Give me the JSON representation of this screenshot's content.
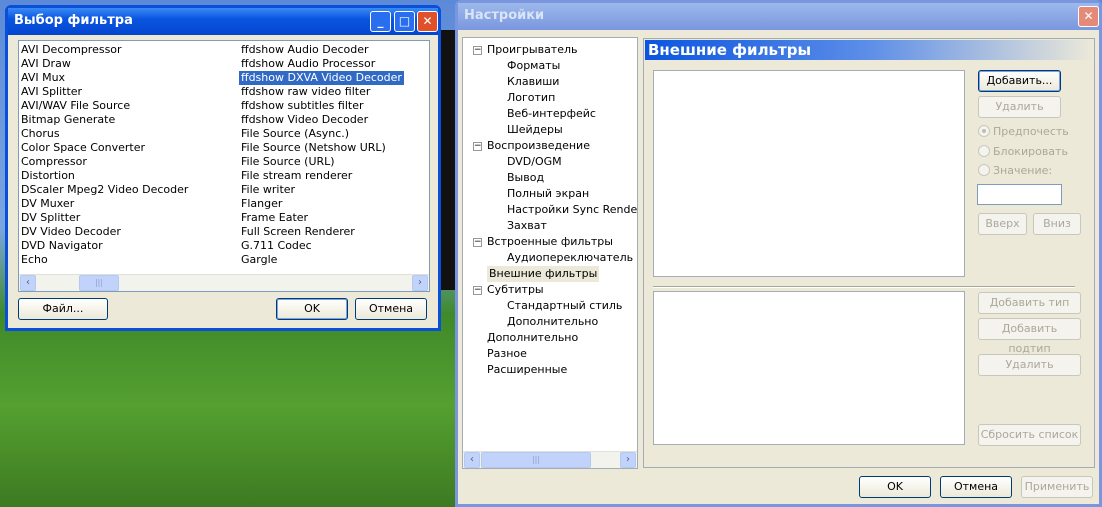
{
  "filter_dialog": {
    "title": "Выбор фильтра",
    "col1": [
      "AVI Decompressor",
      "AVI Draw",
      "AVI Mux",
      "AVI Splitter",
      "AVI/WAV File Source",
      "Bitmap Generate",
      "Chorus",
      "Color Space Converter",
      "Compressor",
      "Distortion",
      "DScaler Mpeg2 Video Decoder",
      "DV Muxer",
      "DV Splitter",
      "DV Video Decoder",
      "DVD Navigator",
      "Echo"
    ],
    "col2": [
      "ffdshow Audio Decoder",
      "ffdshow Audio Processor",
      "ffdshow DXVA Video Decoder",
      "ffdshow raw video filter",
      "ffdshow subtitles filter",
      "ffdshow Video Decoder",
      "File Source (Async.)",
      "File Source (Netshow URL)",
      "File Source (URL)",
      "File stream renderer",
      "File writer",
      "Flanger",
      "Frame Eater",
      "Full Screen Renderer",
      "G.711 Codec",
      "Gargle"
    ],
    "selected": "ffdshow DXVA Video Decoder",
    "file_button": "Файл...",
    "ok_button": "OK",
    "cancel_button": "Отмена"
  },
  "settings": {
    "title": "Настройки",
    "tree": [
      {
        "label": "Проигрыватель",
        "level": 0,
        "expander": true
      },
      {
        "label": "Форматы",
        "level": 1
      },
      {
        "label": "Клавиши",
        "level": 1
      },
      {
        "label": "Логотип",
        "level": 1
      },
      {
        "label": "Веб-интерфейс",
        "level": 1
      },
      {
        "label": "Шейдеры",
        "level": 1
      },
      {
        "label": "Воспроизведение",
        "level": 0,
        "expander": true
      },
      {
        "label": "DVD/OGM",
        "level": 1
      },
      {
        "label": "Вывод",
        "level": 1
      },
      {
        "label": "Полный экран",
        "level": 1
      },
      {
        "label": "Настройки Sync Renderer",
        "level": 1
      },
      {
        "label": "Захват",
        "level": 1
      },
      {
        "label": "Встроенные фильтры",
        "level": 0,
        "expander": true
      },
      {
        "label": "Аудиопереключатель",
        "level": 1
      },
      {
        "label": "Внешние фильтры",
        "level": 0,
        "selected": true
      },
      {
        "label": "Субтитры",
        "level": 0,
        "expander": true
      },
      {
        "label": "Стандартный стиль",
        "level": 1
      },
      {
        "label": "Дополнительно",
        "level": 1
      },
      {
        "label": "Дополнительно",
        "level": 0
      },
      {
        "label": "Разное",
        "level": 0
      },
      {
        "label": "Расширенные",
        "level": 0
      }
    ],
    "page_title": "Внешние фильтры",
    "add_button": "Добавить...",
    "remove_button": "Удалить",
    "radio_prefer": "Предпочесть",
    "radio_block": "Блокировать",
    "radio_value": "Значение:",
    "value_input": "",
    "up_button": "Вверх",
    "down_button": "Вниз",
    "add_type_button": "Добавить тип",
    "add_subtype_button": "Добавить подтип",
    "remove2_button": "Удалить",
    "reset_button": "Сбросить список",
    "ok_button": "OK",
    "cancel_button": "Отмена",
    "apply_button": "Применить"
  }
}
